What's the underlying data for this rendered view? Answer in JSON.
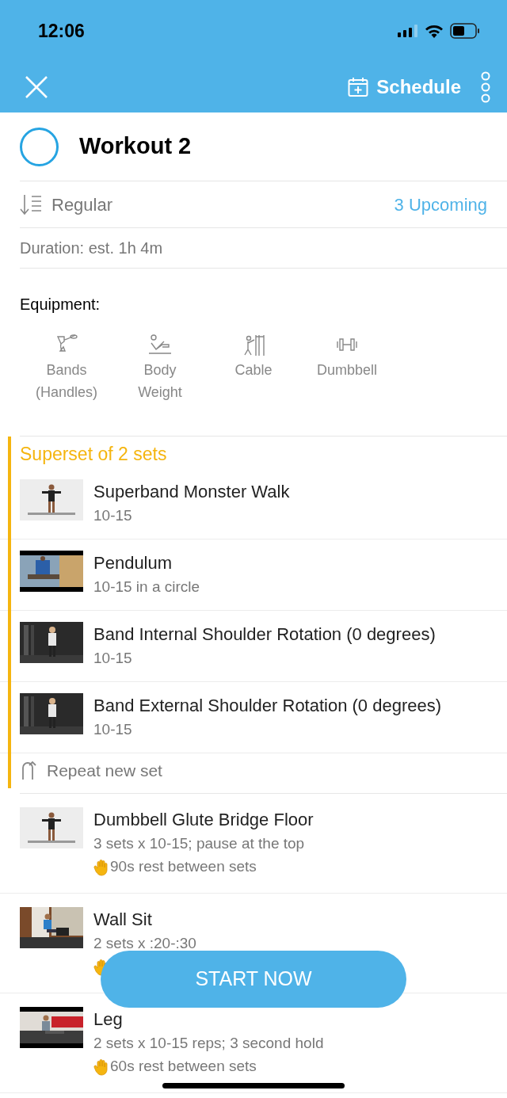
{
  "status_bar": {
    "time": "12:06"
  },
  "nav": {
    "schedule_label": "Schedule"
  },
  "workout": {
    "title": "Workout 2",
    "completed": false,
    "order": "Regular",
    "upcoming": "3 Upcoming",
    "duration": "Duration: est. 1h 4m"
  },
  "equipment": {
    "label": "Equipment:",
    "items": [
      {
        "kind": "bands",
        "label": "Bands\n(Handles)"
      },
      {
        "kind": "body",
        "label": "Body\nWeight"
      },
      {
        "kind": "cable",
        "label": "Cable"
      },
      {
        "kind": "dumbbell",
        "label": "Dumbbell"
      }
    ]
  },
  "superset": {
    "title": "Superset of 2 sets",
    "repeat_label": "Repeat new set",
    "exercises": [
      {
        "name": "Superband Monster Walk",
        "detail": "10-15"
      },
      {
        "name": "Pendulum",
        "detail": "10-15 in a circle"
      },
      {
        "name": "Band Internal Shoulder Rotation (0 degrees)",
        "detail": "10-15"
      },
      {
        "name": "Band External Shoulder Rotation (0 degrees)",
        "detail": "10-15"
      }
    ]
  },
  "exercises": [
    {
      "name": "Dumbbell Glute Bridge Floor",
      "detail": "3 sets x 10-15; pause at the top",
      "rest": "90s rest between sets"
    },
    {
      "name": "Wall Sit",
      "detail": "2 sets x :20-:30"
    },
    {
      "name": "Leg",
      "detail": "2 sets x 10-15 reps; 3 second hold",
      "rest": "60s rest between sets"
    }
  ],
  "start_button": "START NOW"
}
